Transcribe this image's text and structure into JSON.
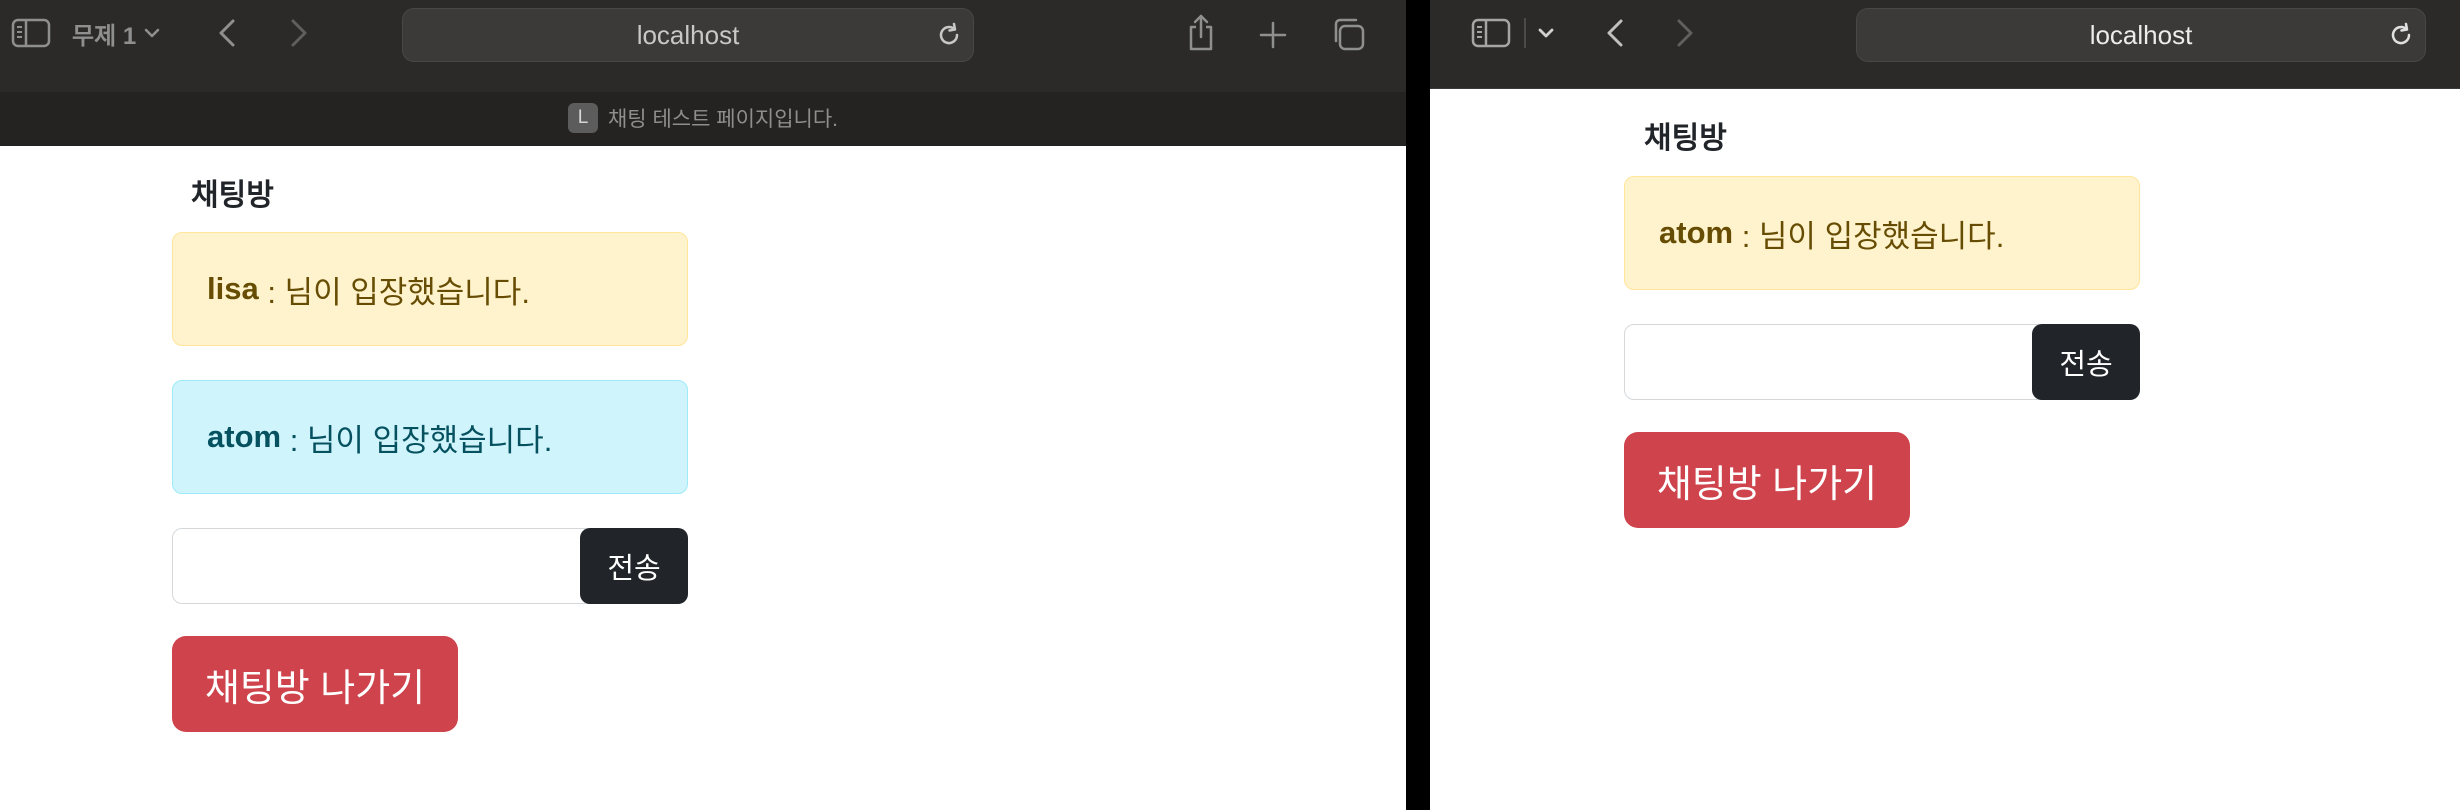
{
  "left_window": {
    "tab_group_label": "무제 1",
    "address": "localhost",
    "tab": {
      "favicon_letter": "L",
      "title": "채팅 테스트 페이지입니다."
    },
    "page": {
      "heading": "채팅방",
      "messages": [
        {
          "user": "lisa",
          "text": " : 님이 입장했습니다.",
          "style": "warning"
        },
        {
          "user": "atom",
          "text": " : 님이 입장했습니다.",
          "style": "info"
        }
      ],
      "message_input_value": "",
      "send_label": "전송",
      "leave_label": "채팅방 나가기"
    }
  },
  "right_window": {
    "address": "localhost",
    "page": {
      "heading": "채팅방",
      "messages": [
        {
          "user": "atom",
          "text": " : 님이 입장했습니다.",
          "style": "warning"
        }
      ],
      "message_input_value": "",
      "send_label": "전송",
      "leave_label": "채팅방 나가기"
    }
  },
  "icons": {
    "sidebar": "sidebar-icon",
    "chevron_down": "chevron-down-icon",
    "back": "chevron-left-icon",
    "forward": "chevron-right-icon",
    "reload": "reload-icon",
    "share": "share-icon",
    "new_tab": "plus-icon",
    "tab_overview": "tabs-overview-icon"
  },
  "colors": {
    "toolbar": "#2b2a29",
    "warning_bg": "#fff3cd",
    "info_bg": "#cff4fc",
    "send_button": "#212529",
    "leave_button": "#cf434c"
  }
}
